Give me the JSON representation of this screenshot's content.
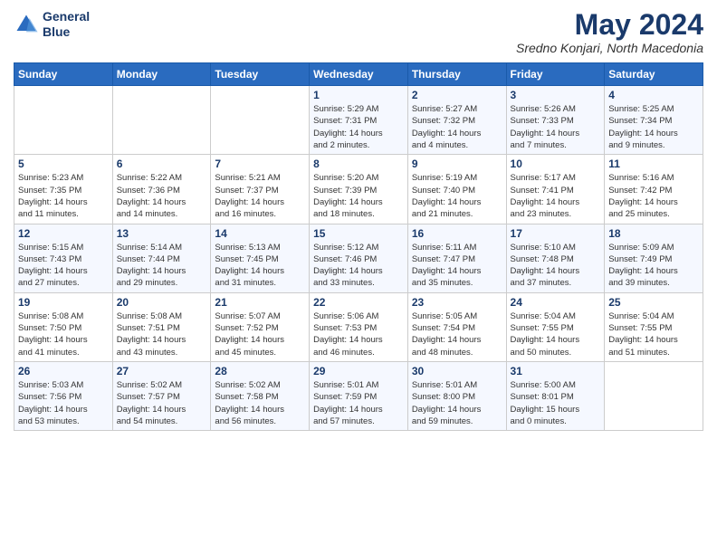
{
  "header": {
    "logo_line1": "General",
    "logo_line2": "Blue",
    "month": "May 2024",
    "location": "Sredno Konjari, North Macedonia"
  },
  "weekdays": [
    "Sunday",
    "Monday",
    "Tuesday",
    "Wednesday",
    "Thursday",
    "Friday",
    "Saturday"
  ],
  "rows": [
    [
      {
        "day": "",
        "info": ""
      },
      {
        "day": "",
        "info": ""
      },
      {
        "day": "",
        "info": ""
      },
      {
        "day": "1",
        "info": "Sunrise: 5:29 AM\nSunset: 7:31 PM\nDaylight: 14 hours\nand 2 minutes."
      },
      {
        "day": "2",
        "info": "Sunrise: 5:27 AM\nSunset: 7:32 PM\nDaylight: 14 hours\nand 4 minutes."
      },
      {
        "day": "3",
        "info": "Sunrise: 5:26 AM\nSunset: 7:33 PM\nDaylight: 14 hours\nand 7 minutes."
      },
      {
        "day": "4",
        "info": "Sunrise: 5:25 AM\nSunset: 7:34 PM\nDaylight: 14 hours\nand 9 minutes."
      }
    ],
    [
      {
        "day": "5",
        "info": "Sunrise: 5:23 AM\nSunset: 7:35 PM\nDaylight: 14 hours\nand 11 minutes."
      },
      {
        "day": "6",
        "info": "Sunrise: 5:22 AM\nSunset: 7:36 PM\nDaylight: 14 hours\nand 14 minutes."
      },
      {
        "day": "7",
        "info": "Sunrise: 5:21 AM\nSunset: 7:37 PM\nDaylight: 14 hours\nand 16 minutes."
      },
      {
        "day": "8",
        "info": "Sunrise: 5:20 AM\nSunset: 7:39 PM\nDaylight: 14 hours\nand 18 minutes."
      },
      {
        "day": "9",
        "info": "Sunrise: 5:19 AM\nSunset: 7:40 PM\nDaylight: 14 hours\nand 21 minutes."
      },
      {
        "day": "10",
        "info": "Sunrise: 5:17 AM\nSunset: 7:41 PM\nDaylight: 14 hours\nand 23 minutes."
      },
      {
        "day": "11",
        "info": "Sunrise: 5:16 AM\nSunset: 7:42 PM\nDaylight: 14 hours\nand 25 minutes."
      }
    ],
    [
      {
        "day": "12",
        "info": "Sunrise: 5:15 AM\nSunset: 7:43 PM\nDaylight: 14 hours\nand 27 minutes."
      },
      {
        "day": "13",
        "info": "Sunrise: 5:14 AM\nSunset: 7:44 PM\nDaylight: 14 hours\nand 29 minutes."
      },
      {
        "day": "14",
        "info": "Sunrise: 5:13 AM\nSunset: 7:45 PM\nDaylight: 14 hours\nand 31 minutes."
      },
      {
        "day": "15",
        "info": "Sunrise: 5:12 AM\nSunset: 7:46 PM\nDaylight: 14 hours\nand 33 minutes."
      },
      {
        "day": "16",
        "info": "Sunrise: 5:11 AM\nSunset: 7:47 PM\nDaylight: 14 hours\nand 35 minutes."
      },
      {
        "day": "17",
        "info": "Sunrise: 5:10 AM\nSunset: 7:48 PM\nDaylight: 14 hours\nand 37 minutes."
      },
      {
        "day": "18",
        "info": "Sunrise: 5:09 AM\nSunset: 7:49 PM\nDaylight: 14 hours\nand 39 minutes."
      }
    ],
    [
      {
        "day": "19",
        "info": "Sunrise: 5:08 AM\nSunset: 7:50 PM\nDaylight: 14 hours\nand 41 minutes."
      },
      {
        "day": "20",
        "info": "Sunrise: 5:08 AM\nSunset: 7:51 PM\nDaylight: 14 hours\nand 43 minutes."
      },
      {
        "day": "21",
        "info": "Sunrise: 5:07 AM\nSunset: 7:52 PM\nDaylight: 14 hours\nand 45 minutes."
      },
      {
        "day": "22",
        "info": "Sunrise: 5:06 AM\nSunset: 7:53 PM\nDaylight: 14 hours\nand 46 minutes."
      },
      {
        "day": "23",
        "info": "Sunrise: 5:05 AM\nSunset: 7:54 PM\nDaylight: 14 hours\nand 48 minutes."
      },
      {
        "day": "24",
        "info": "Sunrise: 5:04 AM\nSunset: 7:55 PM\nDaylight: 14 hours\nand 50 minutes."
      },
      {
        "day": "25",
        "info": "Sunrise: 5:04 AM\nSunset: 7:55 PM\nDaylight: 14 hours\nand 51 minutes."
      }
    ],
    [
      {
        "day": "26",
        "info": "Sunrise: 5:03 AM\nSunset: 7:56 PM\nDaylight: 14 hours\nand 53 minutes."
      },
      {
        "day": "27",
        "info": "Sunrise: 5:02 AM\nSunset: 7:57 PM\nDaylight: 14 hours\nand 54 minutes."
      },
      {
        "day": "28",
        "info": "Sunrise: 5:02 AM\nSunset: 7:58 PM\nDaylight: 14 hours\nand 56 minutes."
      },
      {
        "day": "29",
        "info": "Sunrise: 5:01 AM\nSunset: 7:59 PM\nDaylight: 14 hours\nand 57 minutes."
      },
      {
        "day": "30",
        "info": "Sunrise: 5:01 AM\nSunset: 8:00 PM\nDaylight: 14 hours\nand 59 minutes."
      },
      {
        "day": "31",
        "info": "Sunrise: 5:00 AM\nSunset: 8:01 PM\nDaylight: 15 hours\nand 0 minutes."
      },
      {
        "day": "",
        "info": ""
      }
    ]
  ]
}
